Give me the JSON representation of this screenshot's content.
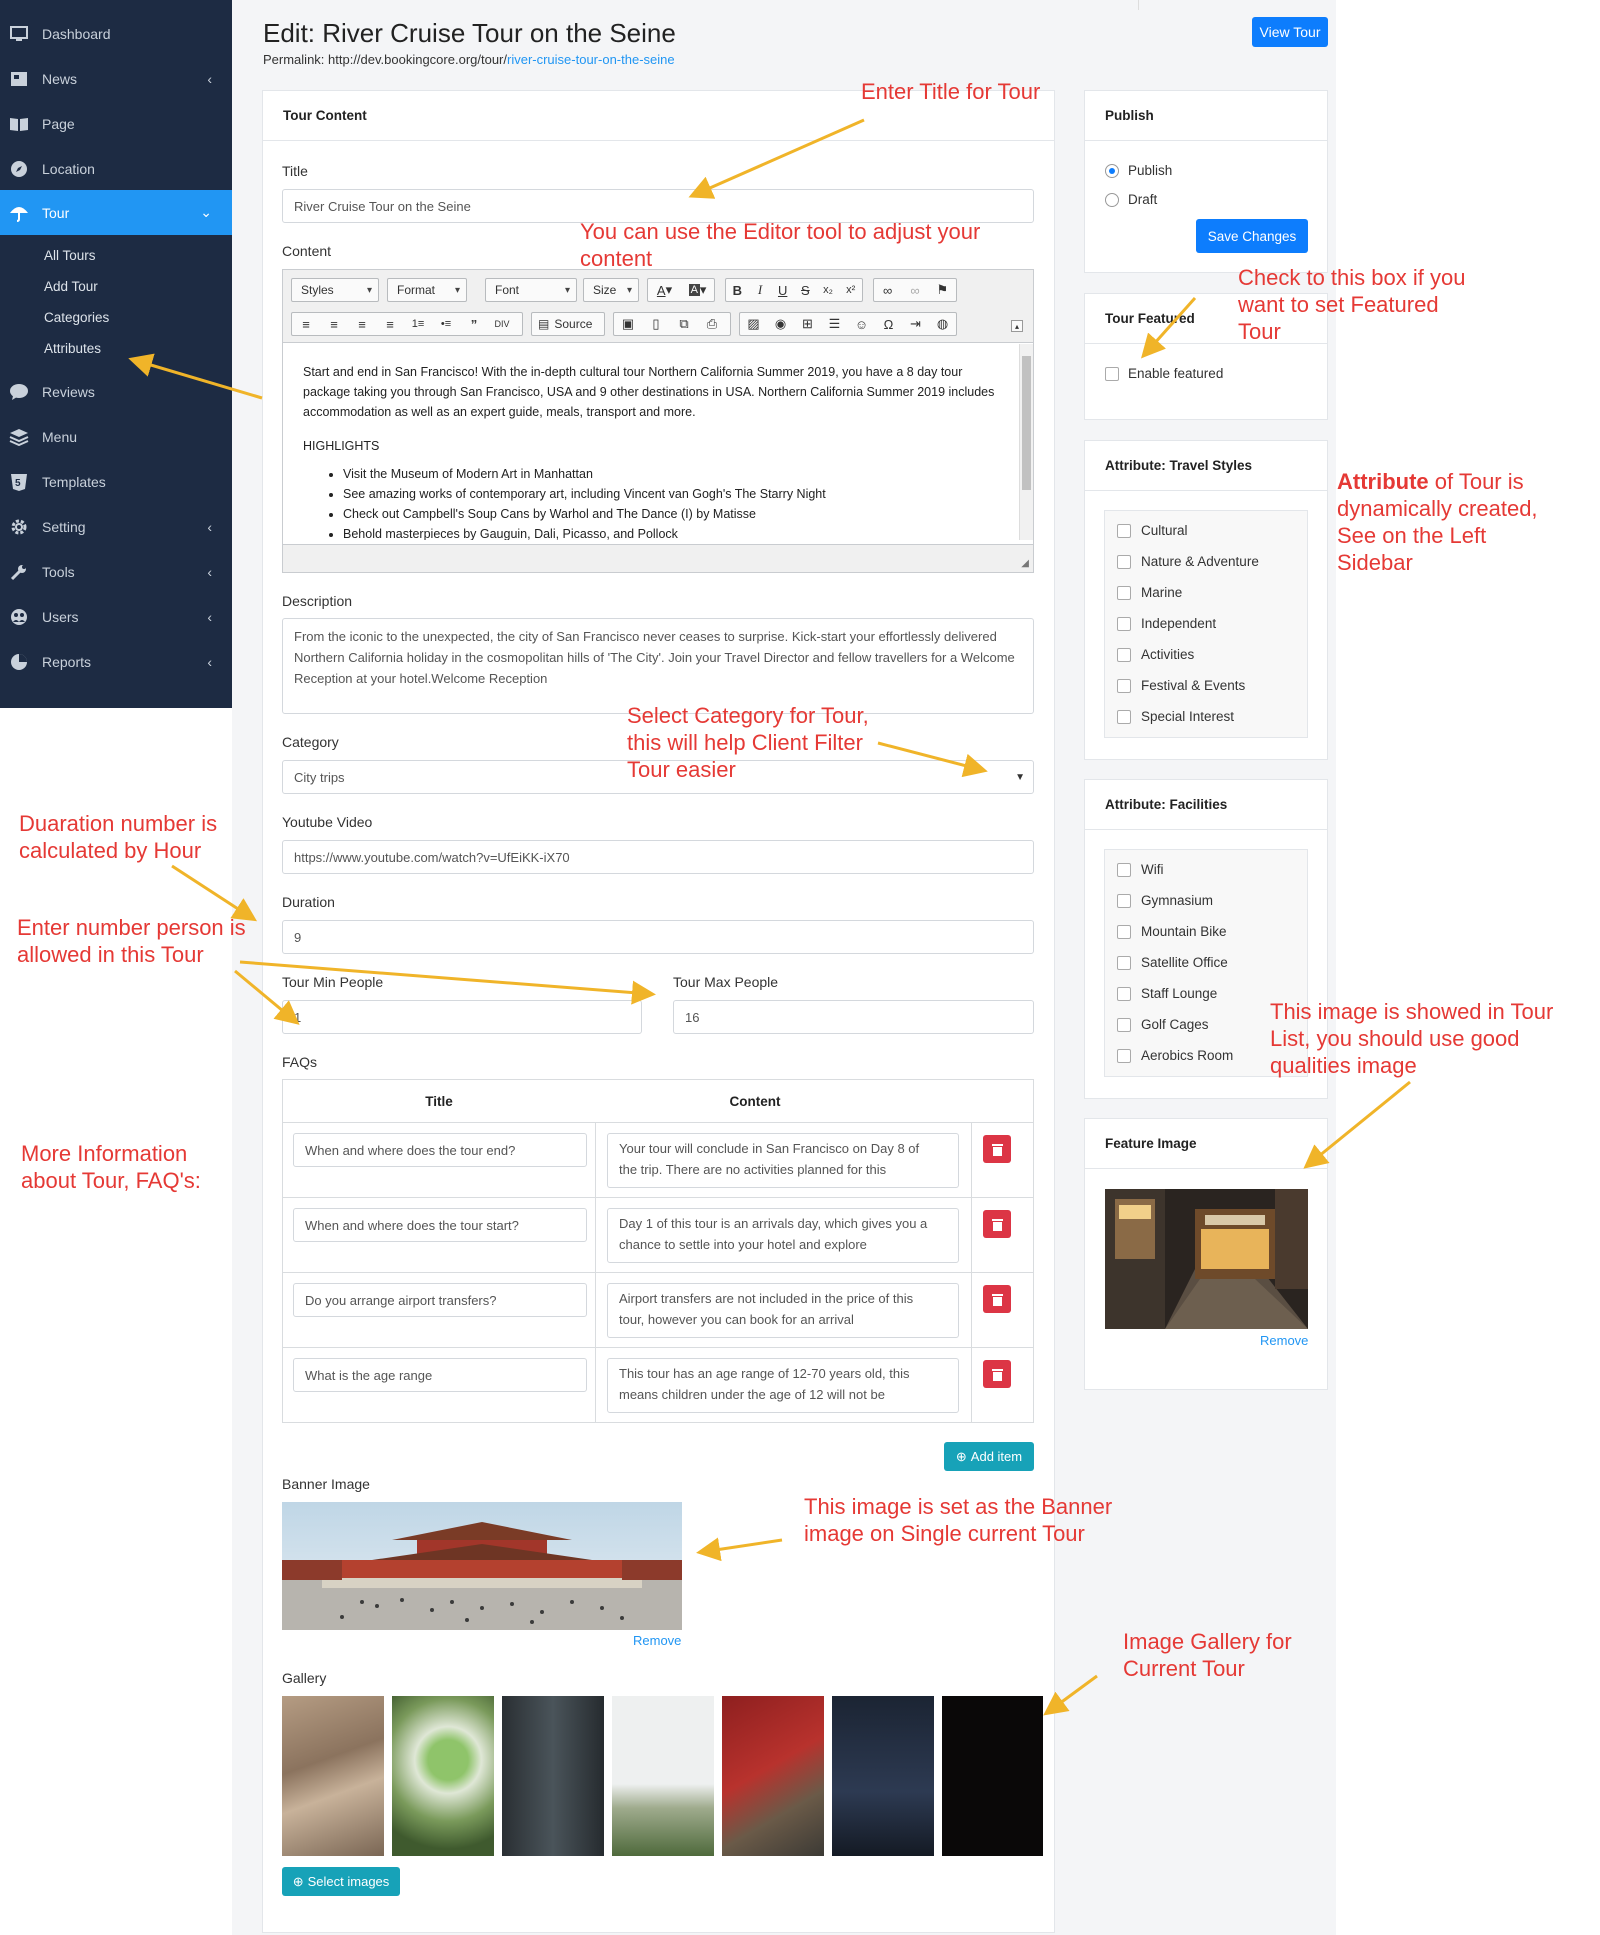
{
  "sidebar": {
    "items": [
      {
        "label": "Dashboard",
        "icon": "monitor-icon"
      },
      {
        "label": "News",
        "icon": "newspaper-icon",
        "chevron": true
      },
      {
        "label": "Page",
        "icon": "book-icon"
      },
      {
        "label": "Location",
        "icon": "compass-icon"
      },
      {
        "label": "Tour",
        "icon": "umbrella-icon",
        "chevron": true,
        "active": true
      },
      {
        "label": "Reviews",
        "icon": "comment-icon"
      },
      {
        "label": "Menu",
        "icon": "layers-icon"
      },
      {
        "label": "Templates",
        "icon": "html5-icon"
      },
      {
        "label": "Setting",
        "icon": "gear-icon",
        "chevron": true
      },
      {
        "label": "Tools",
        "icon": "wrench-icon",
        "chevron": true
      },
      {
        "label": "Users",
        "icon": "users-icon",
        "chevron": true
      },
      {
        "label": "Reports",
        "icon": "pie-chart-icon",
        "chevron": true
      }
    ],
    "sub_items": [
      "All Tours",
      "Add Tour",
      "Categories",
      "Attributes"
    ]
  },
  "header": {
    "title": "Edit: River Cruise Tour on the Seine",
    "permalink_label": "Permalink: http://dev.bookingcore.org/tour/",
    "permalink_slug": "river-cruise-tour-on-the-seine",
    "view_button": "View Tour"
  },
  "tour_content": {
    "heading": "Tour Content",
    "title_label": "Title",
    "title_value": "River Cruise Tour on the Seine",
    "content_label": "Content",
    "editor": {
      "styles": "Styles",
      "format": "Format",
      "font": "Font",
      "size": "Size",
      "source": "Source",
      "paragraph": "Start and end in San Francisco! With the in-depth cultural tour Northern California Summer 2019, you have a 8 day tour package taking you through San Francisco, USA and 9 other destinations in USA. Northern California Summer 2019 includes accommodation as well as an expert guide, meals, transport and more.",
      "highlights_heading": "HIGHLIGHTS",
      "highlights": [
        "Visit the Museum of Modern Art in Manhattan",
        "See amazing works of contemporary art, including Vincent van Gogh's The Starry Night",
        "Check out Campbell's Soup Cans by Warhol and The Dance (I) by Matisse",
        "Behold masterpieces by Gauguin, Dali, Picasso, and Pollock"
      ]
    },
    "description_label": "Description",
    "description_value": "From the iconic to the unexpected, the city of San Francisco never ceases to surprise. Kick-start your effortlessly delivered Northern California holiday in the cosmopolitan hills of 'The City'. Join your Travel Director and fellow travellers for a Welcome Reception at your hotel.Welcome Reception",
    "category_label": "Category",
    "category_value": "City trips",
    "youtube_label": "Youtube Video",
    "youtube_value": "https://www.youtube.com/watch?v=UfEiKK-iX70",
    "duration_label": "Duration",
    "duration_value": "9",
    "min_people_label": "Tour Min People",
    "min_people_value": "1",
    "max_people_label": "Tour Max People",
    "max_people_value": "16",
    "faqs_label": "FAQs",
    "faq_headers": {
      "title": "Title",
      "content": "Content"
    },
    "faqs": [
      {
        "title": "When and where does the tour end?",
        "content": "Your tour will conclude in San Francisco on Day 8 of the trip. There are no activities planned for this"
      },
      {
        "title": "When and where does the tour start?",
        "content": "Day 1 of this tour is an arrivals day, which gives you a chance to settle into your hotel and explore"
      },
      {
        "title": "Do you arrange airport transfers?",
        "content": "Airport transfers are not included in the price of this tour, however you can book for an arrival"
      },
      {
        "title": "What is the age range",
        "content": "This tour has an age range of 12-70 years old, this means children under the age of 12 will not be"
      }
    ],
    "add_item": "Add item",
    "banner_label": "Banner Image",
    "remove": "Remove",
    "gallery_label": "Gallery",
    "select_images": "Select images"
  },
  "publish": {
    "heading": "Publish",
    "options": [
      "Publish",
      "Draft"
    ],
    "selected": "Publish",
    "save": "Save Changes"
  },
  "featured": {
    "heading": "Tour Featured",
    "checkbox_label": "Enable featured"
  },
  "travel_styles": {
    "heading": "Attribute: Travel Styles",
    "items": [
      "Cultural",
      "Nature & Adventure",
      "Marine",
      "Independent",
      "Activities",
      "Festival & Events",
      "Special Interest"
    ]
  },
  "facilities": {
    "heading": "Attribute: Facilities",
    "items": [
      "Wifi",
      "Gymnasium",
      "Mountain Bike",
      "Satellite Office",
      "Staff Lounge",
      "Golf Cages",
      "Aerobics Room"
    ]
  },
  "feature_image": {
    "heading": "Feature Image",
    "remove": "Remove"
  },
  "annotations": {
    "title": "Enter Title for Tour",
    "editor": "You can use the Editor tool to adjust your content",
    "featured": "Check to this box if you want to set Featured Tour",
    "attribute_bold": "Attribute",
    "attribute_rest": " of Tour is dynamically created, See on the Left Sidebar",
    "category": "Select Category for Tour, this will help Client Filter Tour easier",
    "duration": "Duaration number is calculated by Hour",
    "people": "Enter number person is allowed in this Tour",
    "faq": "More Information about Tour, FAQ's:",
    "feature_image": "This image is showed in Tour List, you should use good qualities image",
    "banner": "This image is set as the Banner image on Single current Tour",
    "gallery": "Image Gallery for Current Tour"
  },
  "colors": {
    "sidebar_bg": "#1d2b43",
    "active": "#2196f3",
    "primary": "#0d7dfd",
    "danger": "#dc3545",
    "info": "#17a2b8",
    "annotation": "#e53935",
    "arrow": "#f0b429"
  }
}
